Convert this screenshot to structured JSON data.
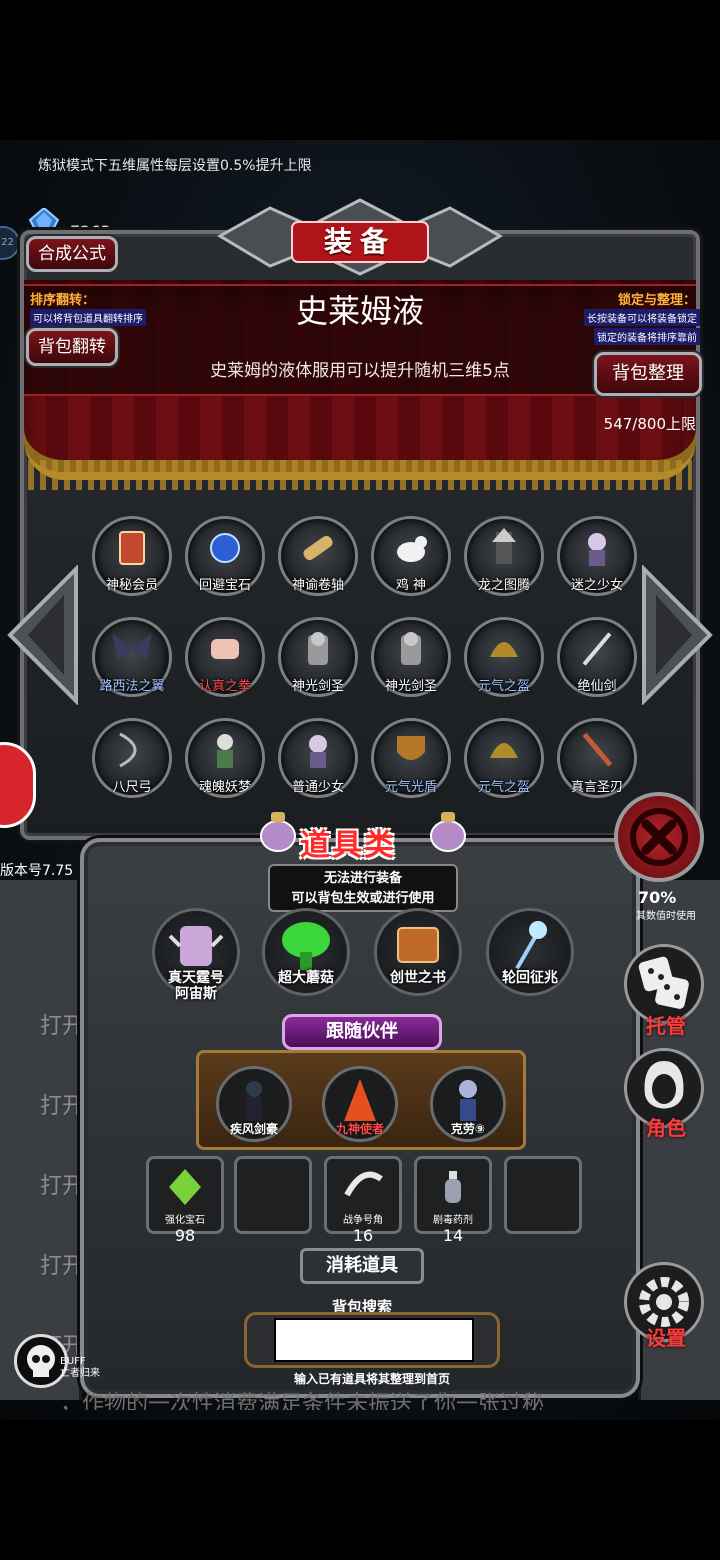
{
  "notice": "炼狱模式下五维属性每层设置0.5%提升上限",
  "gem": {
    "badge": "22",
    "count": "7263"
  },
  "panel": {
    "title": "装备",
    "recipe_button": "合成公式",
    "flip_button": "背包翻转",
    "sort_button": "背包整理",
    "sort_title": "排序翻转：",
    "sort_desc": "可以将背包道具翻转排序",
    "lock_title": "锁定与整理：",
    "lock_desc1": "长按装备可以将装备锁定",
    "lock_desc2": "锁定的装备将排序靠前",
    "item_name": "史莱姆液",
    "item_desc": "史莱姆的液体服用可以提升随机三维5点",
    "capacity": "547/800上限"
  },
  "grid": [
    {
      "name": "神秘会员",
      "icon": "card-icon",
      "color": "white"
    },
    {
      "name": "回避宝石",
      "icon": "blue-gem-icon",
      "color": "white"
    },
    {
      "name": "神谕卷轴",
      "icon": "scroll-icon",
      "color": "white"
    },
    {
      "name": "鸡 神",
      "icon": "chicken-icon",
      "color": "white"
    },
    {
      "name": "龙之图腾",
      "icon": "totem-icon",
      "color": "white"
    },
    {
      "name": "迷之少女",
      "icon": "girl-icon",
      "color": "white"
    },
    {
      "name": "路西法之翼",
      "icon": "wings-icon",
      "color": "blue"
    },
    {
      "name": "认真之拳",
      "icon": "fist-icon",
      "color": "red"
    },
    {
      "name": "神光剑圣",
      "icon": "knight-icon",
      "color": "white"
    },
    {
      "name": "神光剑圣",
      "icon": "knight-icon",
      "color": "white"
    },
    {
      "name": "元气之盔",
      "icon": "helmet-icon",
      "color": "blue"
    },
    {
      "name": "绝仙剑",
      "icon": "sword-icon",
      "color": "white"
    },
    {
      "name": "八尺弓",
      "icon": "bow-icon",
      "color": "white"
    },
    {
      "name": "魂魄妖梦",
      "icon": "swordswoman-icon",
      "color": "white"
    },
    {
      "name": "普通少女",
      "icon": "girl-icon",
      "color": "white"
    },
    {
      "name": "元气光盾",
      "icon": "shield-icon",
      "color": "blue"
    },
    {
      "name": "元气之盔",
      "icon": "helmet-icon",
      "color": "blue"
    },
    {
      "name": "真言圣刃",
      "icon": "blade-icon",
      "color": "white"
    }
  ],
  "version": "版本号7.75",
  "props": {
    "title": "道具类",
    "sub1": "无法进行装备",
    "sub2": "可以背包生效或进行使用",
    "items": [
      {
        "name": "真天霆号\n阿宙斯",
        "icon": "robot-icon"
      },
      {
        "name": "超大蘑菇",
        "icon": "mushroom-icon"
      },
      {
        "name": "创世之书",
        "icon": "book-icon"
      },
      {
        "name": "轮回征兆",
        "icon": "ice-staff-icon"
      }
    ]
  },
  "companions": {
    "title": "跟随伙伴",
    "items": [
      {
        "name": "疾风剑豪",
        "icon": "swordsman-icon",
        "color": "white"
      },
      {
        "name": "九神使者",
        "icon": "fox-icon",
        "color": "red"
      },
      {
        "name": "克劳⑨",
        "icon": "maid-icon",
        "color": "white"
      }
    ]
  },
  "consumables": {
    "title": "消耗道具",
    "slots": [
      {
        "name": "强化宝石",
        "count": "98",
        "icon": "green-gem-icon"
      },
      {
        "name": "",
        "count": "",
        "icon": ""
      },
      {
        "name": "战争号角",
        "count": "16",
        "icon": "horn-icon"
      },
      {
        "name": "剧毒药剂",
        "count": "14",
        "icon": "poison-icon"
      },
      {
        "name": "",
        "count": "",
        "icon": ""
      }
    ]
  },
  "search": {
    "label": "背包搜索",
    "value": "",
    "hint": "输入已有道具将其整理到首页"
  },
  "right": {
    "badge1": "70%",
    "badge2": "其数值时使用",
    "pipe_label": "托管",
    "role_label": "角色",
    "settings_label": "设置"
  },
  "buff": {
    "line1": "BUFF",
    "line2": "亡者归来"
  },
  "log": {
    "lines": [
      "打开",
      "打开了",
      "打开",
      "打开",
      "打开了精致的宝箱"
    ],
    "bottom": "，作物的一次性消费满足条件未振送了你一张过秘"
  }
}
